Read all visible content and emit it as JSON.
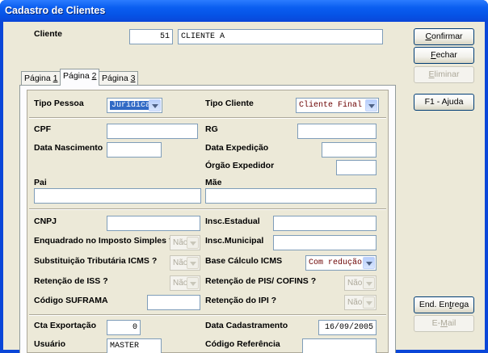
{
  "window": {
    "title": "Cadastro de Clientes"
  },
  "header": {
    "cliente_label": "Cliente",
    "cliente_code": "51",
    "cliente_name": "CLIENTE A"
  },
  "tabs": [
    {
      "label": "Página ",
      "num": "1"
    },
    {
      "label": "Página ",
      "num": "2"
    },
    {
      "label": "Página ",
      "num": "3"
    }
  ],
  "buttons": {
    "confirmar": {
      "first": "C",
      "rest": "onfirmar"
    },
    "fechar": {
      "first": "F",
      "rest": "echar"
    },
    "eliminar": {
      "first": "E",
      "rest": "liminar"
    },
    "ajuda": "F1 - Ajuda",
    "end_entrega": {
      "pre": "End. En",
      "u": "t",
      "post": "rega"
    },
    "email": {
      "pre": "E-",
      "u": "M",
      "post": "ail"
    }
  },
  "form": {
    "tipo_pessoa": {
      "label": "Tipo Pessoa",
      "value": "Jurídica"
    },
    "tipo_cliente": {
      "label": "Tipo Cliente",
      "value": "Cliente Final"
    },
    "cpf": {
      "label": "CPF",
      "value": ""
    },
    "rg": {
      "label": "RG",
      "value": ""
    },
    "data_nascimento": {
      "label": "Data Nascimento",
      "value": ""
    },
    "data_expedicao": {
      "label": "Data Expedição",
      "value": ""
    },
    "orgao_expedidor": {
      "label": "Órgão Expedidor",
      "value": ""
    },
    "pai": {
      "label": "Pai",
      "value": ""
    },
    "mae": {
      "label": "Mãe",
      "value": ""
    },
    "cnpj": {
      "label": "CNPJ",
      "value": ""
    },
    "insc_estadual": {
      "label": "Insc.Estadual",
      "value": ""
    },
    "enquadrado_simples": {
      "label": "Enquadrado no Imposto Simples ?",
      "value": "Não"
    },
    "insc_municipal": {
      "label": "Insc.Municipal",
      "value": ""
    },
    "subst_tributaria": {
      "label": "Substituição Tributária ICMS ?",
      "value": "Não"
    },
    "base_calculo": {
      "label": "Base Cálculo ICMS",
      "value": "Com redução"
    },
    "retencao_iss": {
      "label": "Retenção de ISS ?",
      "value": "Não"
    },
    "retencao_pis": {
      "label": "Retenção de PIS/ COFINS ?",
      "value": "Não"
    },
    "codigo_suframa": {
      "label": "Código SUFRAMA",
      "value": ""
    },
    "retencao_ipi": {
      "label": "Retenção do IPI ?",
      "value": "Não"
    },
    "cta_exportacao": {
      "label": "Cta Exportação",
      "value": "0"
    },
    "data_cadastramento": {
      "label": "Data Cadastramento",
      "value": "16/09/2005"
    },
    "usuario": {
      "label": "Usuário",
      "value": "MASTER"
    },
    "codigo_referencia": {
      "label": "Código Referência",
      "value": ""
    }
  }
}
